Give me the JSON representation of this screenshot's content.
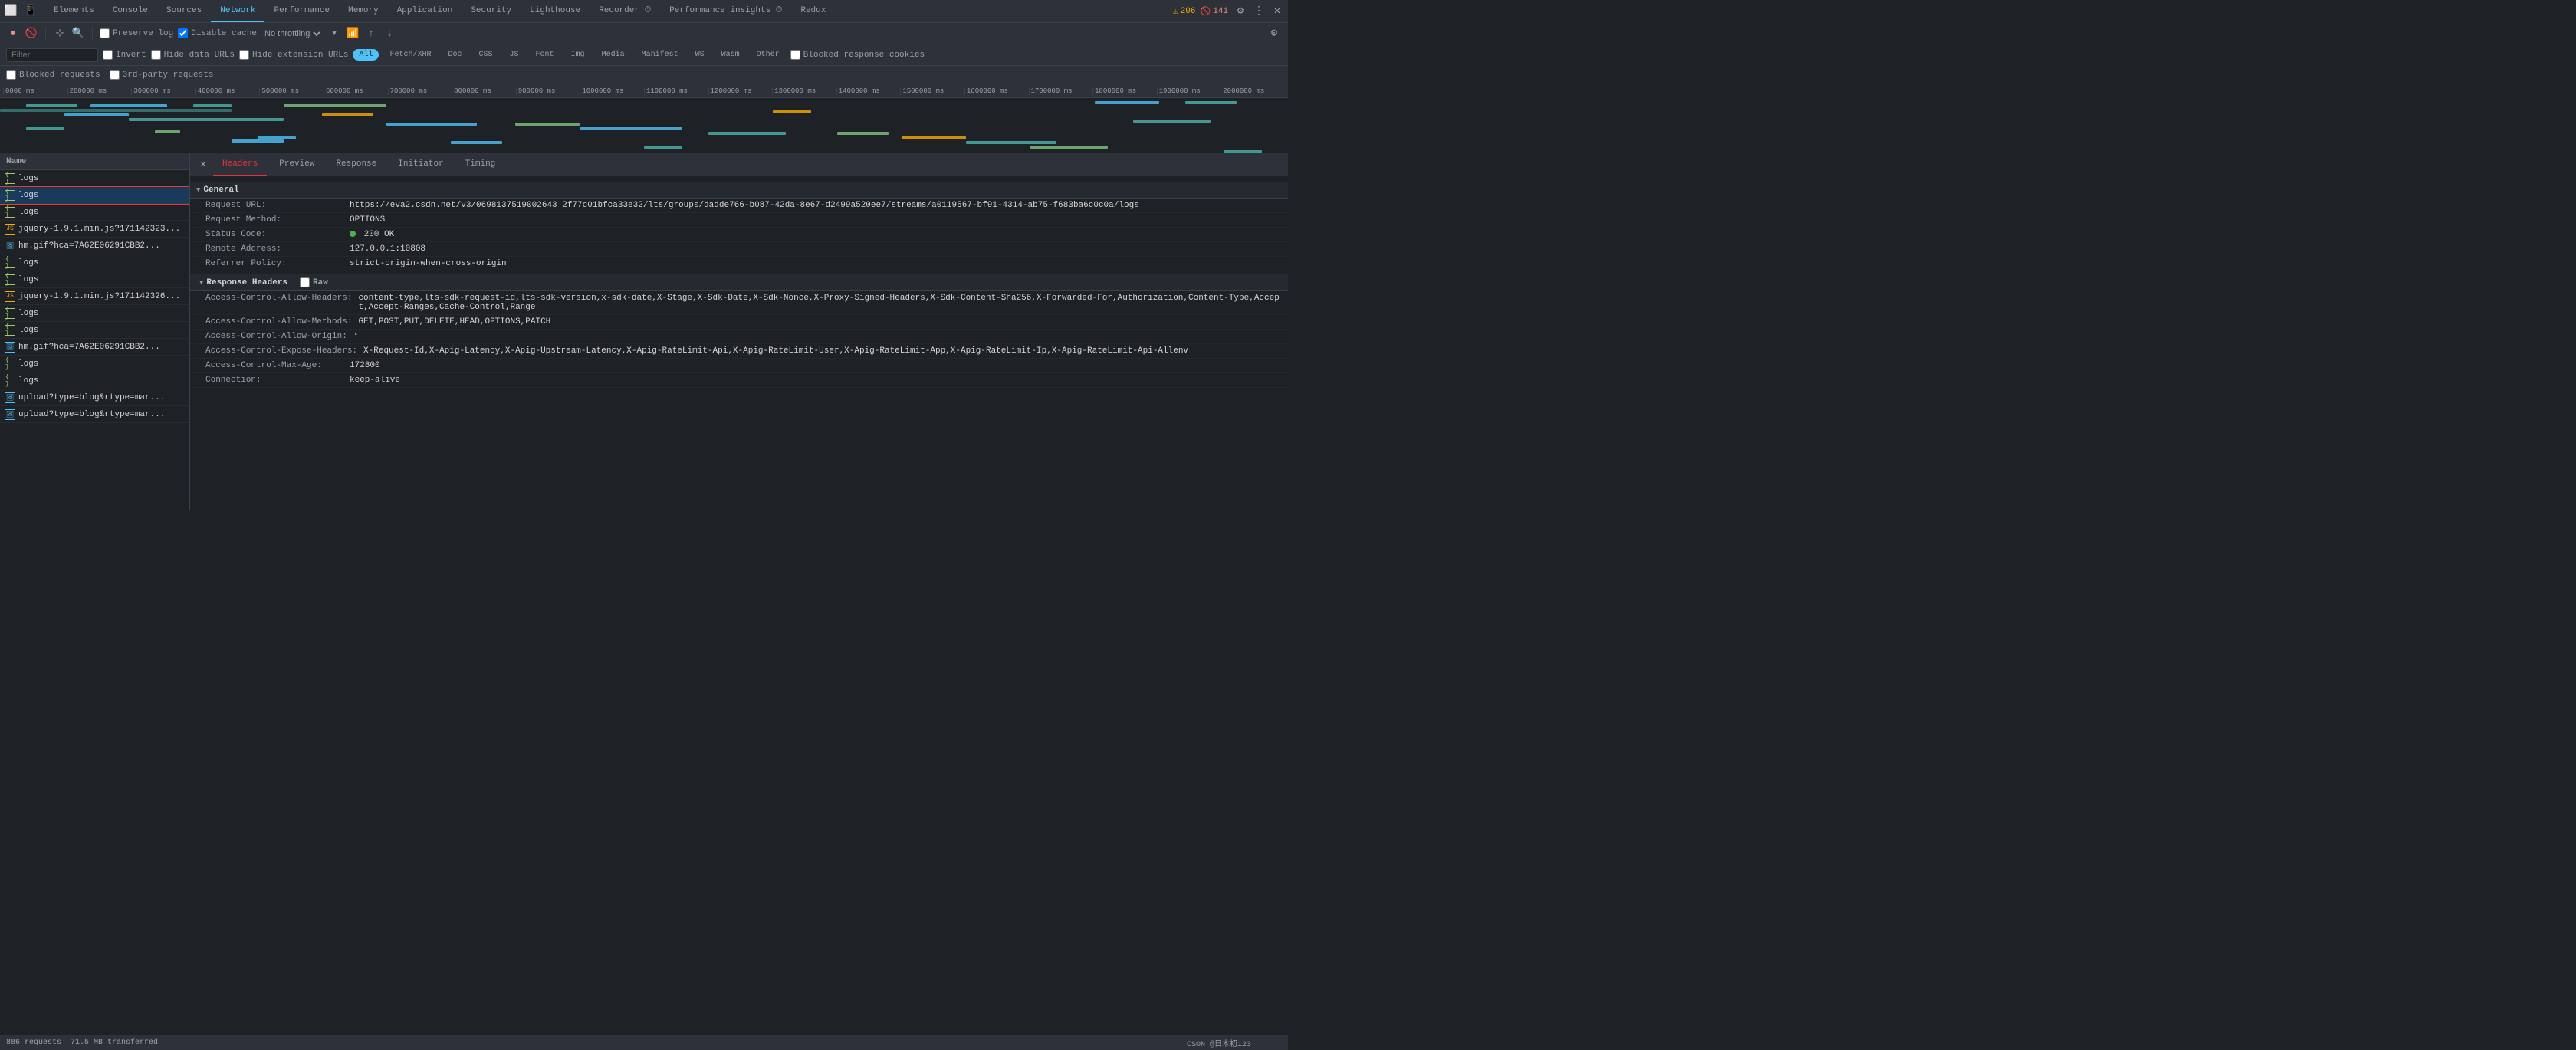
{
  "tabs": {
    "items": [
      {
        "label": "Elements",
        "active": false
      },
      {
        "label": "Console",
        "active": false
      },
      {
        "label": "Sources",
        "active": false
      },
      {
        "label": "Network",
        "active": true
      },
      {
        "label": "Performance",
        "active": false
      },
      {
        "label": "Memory",
        "active": false
      },
      {
        "label": "Application",
        "active": false
      },
      {
        "label": "Security",
        "active": false
      },
      {
        "label": "Lighthouse",
        "active": false
      },
      {
        "label": "Recorder ⏱",
        "active": false
      },
      {
        "label": "Performance insights ⏱",
        "active": false
      },
      {
        "label": "Redux",
        "active": false
      }
    ],
    "warning_count": "206",
    "error_count": "141"
  },
  "toolbar": {
    "preserve_log": "Preserve log",
    "disable_cache": "Disable cache",
    "throttle": "No throttling"
  },
  "filter": {
    "placeholder": "Filter",
    "invert": "Invert",
    "hide_data_urls": "Hide data URLs",
    "hide_ext_urls": "Hide extension URLs",
    "badges": [
      "All",
      "Fetch/XHR",
      "Doc",
      "CSS",
      "JS",
      "Font",
      "Img",
      "Media",
      "Manifest",
      "WS",
      "Wasm",
      "Other"
    ],
    "active_badge": "All",
    "blocked": "Blocked response cookies"
  },
  "blocked_bar": {
    "blocked_requests": "Blocked requests",
    "third_party": "3rd-party requests"
  },
  "timeline": {
    "marks": [
      "0000 ms",
      "200000 ms",
      "300000 ms",
      "400000 ms",
      "500000 ms",
      "600000 ms",
      "700000 ms",
      "800000 ms",
      "900000 ms",
      "1000000 ms",
      "1100000 ms",
      "1200000 ms",
      "1300000 ms",
      "1400000 ms",
      "1500000 ms",
      "1600000 ms",
      "1700000 ms",
      "1800000 ms",
      "1900000 ms",
      "2000000 ms"
    ]
  },
  "request_list": {
    "header": "Name",
    "items": [
      {
        "type": "xhr",
        "name": "logs",
        "selected": false
      },
      {
        "type": "xhr",
        "name": "logs",
        "selected": true
      },
      {
        "type": "xhr",
        "name": "logs",
        "selected": false
      },
      {
        "type": "js",
        "name": "jquery-1.9.1.min.js?171142323...",
        "selected": false
      },
      {
        "type": "img",
        "name": "hm.gif?hca=7A62E06291CBB2...",
        "selected": false
      },
      {
        "type": "xhr",
        "name": "logs",
        "selected": false
      },
      {
        "type": "xhr",
        "name": "logs",
        "selected": false
      },
      {
        "type": "js",
        "name": "jquery-1.9.1.min.js?171142326...",
        "selected": false
      },
      {
        "type": "xhr",
        "name": "logs",
        "selected": false
      },
      {
        "type": "xhr",
        "name": "logs",
        "selected": false
      },
      {
        "type": "img",
        "name": "hm.gif?hca=7A62E06291CBB2...",
        "selected": false
      },
      {
        "type": "xhr",
        "name": "logs",
        "selected": false
      },
      {
        "type": "xhr",
        "name": "logs",
        "selected": false
      },
      {
        "type": "img",
        "name": "upload?type=blog&rtype=mar...",
        "selected": false
      },
      {
        "type": "img",
        "name": "upload?type=blog&rtype=mar...",
        "selected": false
      }
    ]
  },
  "detail_tabs": {
    "items": [
      "Headers",
      "Preview",
      "Response",
      "Initiator",
      "Timing"
    ],
    "active": "Headers"
  },
  "general": {
    "section_title": "General",
    "request_url_label": "Request URL:",
    "request_url_value": "https://eva2.csdn.net/v3/0698137519002643 2f77c01bfca33e32/lts/groups/dadde766-b087-42da-8e67-d2499a520ee7/streams/a0119567-bf91-4314-ab75-f683ba6c0c0a/logs",
    "request_method_label": "Request Method:",
    "request_method_value": "OPTIONS",
    "status_code_label": "Status Code:",
    "status_code_value": "200 OK",
    "remote_address_label": "Remote Address:",
    "remote_address_value": "127.0.0.1:10808",
    "referrer_policy_label": "Referrer Policy:",
    "referrer_policy_value": "strict-origin-when-cross-origin"
  },
  "response_headers": {
    "section_title": "Response Headers",
    "raw_label": "Raw",
    "rows": [
      {
        "name": "Access-Control-Allow-Headers:",
        "value": "content-type,lts-sdk-request-id,lts-sdk-version,x-sdk-date,X-Stage,X-Sdk-Date,X-Sdk-Nonce,X-Proxy-Signed-Headers,X-Sdk-Content-Sha256,X-Forwarded-For,Authorization,Content-Type,Accept,Accept-Ranges,Cache-Control,Range"
      },
      {
        "name": "Access-Control-Allow-Methods:",
        "value": "GET,POST,PUT,DELETE,HEAD,OPTIONS,PATCH"
      },
      {
        "name": "Access-Control-Allow-Origin:",
        "value": "*"
      },
      {
        "name": "Access-Control-Expose-Headers:",
        "value": "X-Request-Id,X-Apig-Latency,X-Apig-Upstream-Latency,X-Apig-RateLimit-Api,X-Apig-RateLimit-User,X-Apig-RateLimit-App,X-Apig-RateLimit-Ip,X-Apig-RateLimit-Api-Allenv"
      },
      {
        "name": "Access-Control-Max-Age:",
        "value": "172800"
      },
      {
        "name": "Connection:",
        "value": "keep-alive"
      }
    ]
  },
  "status_bar": {
    "requests": "886 requests",
    "transferred": "71.5 MB transferred",
    "watermark": "CSON @日木初123"
  }
}
